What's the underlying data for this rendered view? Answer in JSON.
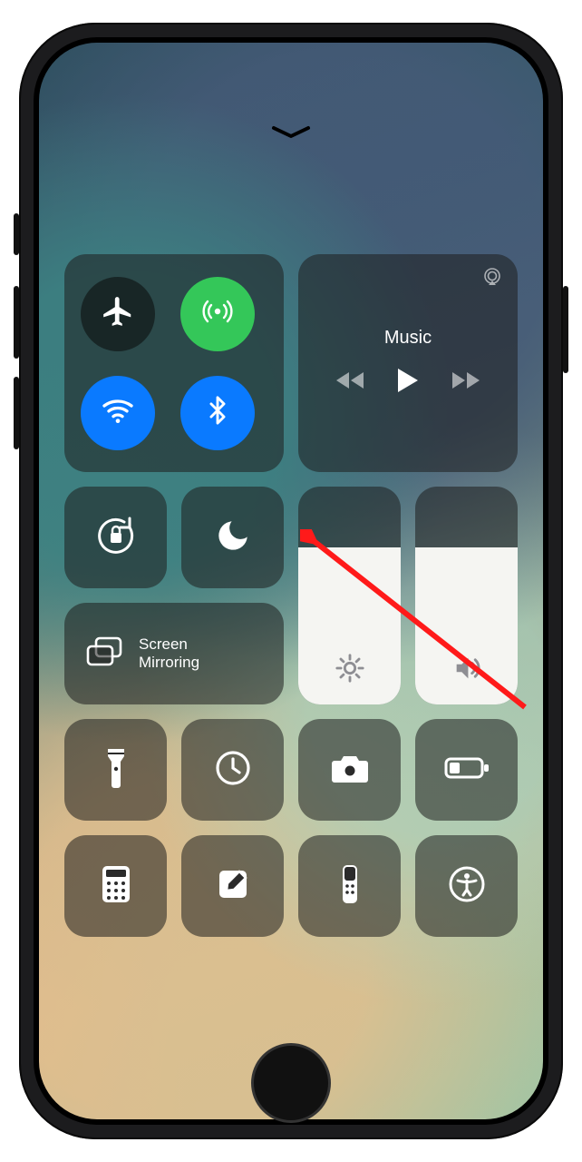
{
  "music": {
    "title": "Music"
  },
  "screen_mirroring": {
    "label": "Screen\nMirroring"
  },
  "connectivity": {
    "airplane": {
      "on": false
    },
    "cellular": {
      "on": true
    },
    "wifi": {
      "on": true
    },
    "bluetooth": {
      "on": true
    }
  },
  "sliders": {
    "brightness_percent": 72,
    "volume_percent": 72
  },
  "toggles": {
    "orientation_lock": false,
    "do_not_disturb": false
  },
  "shortcuts_row1": [
    "flashlight",
    "timer",
    "camera",
    "low-power-mode"
  ],
  "shortcuts_row2": [
    "calculator",
    "notes",
    "apple-tv-remote",
    "accessibility"
  ],
  "annotation": {
    "arrow_to": "do-not-disturb-button",
    "color": "#ff1a1a"
  }
}
